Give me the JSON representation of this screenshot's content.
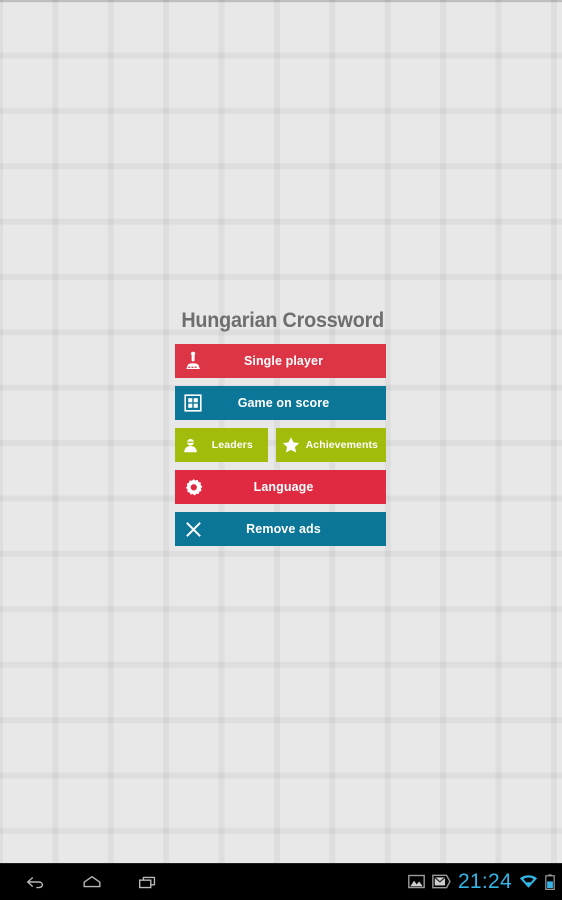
{
  "app": {
    "title": "Hungarian Crossword"
  },
  "menu": {
    "buttons": [
      {
        "id": "single-player",
        "label": "Single player",
        "icon": "joystick-icon",
        "color": "#dc3545"
      },
      {
        "id": "game-on-score",
        "label": "Game on score",
        "icon": "crossword-grid-icon",
        "color": "#0b7697"
      },
      {
        "id": "leaders",
        "label": "Leaders",
        "icon": "person-icon",
        "color": "#a3bb0a"
      },
      {
        "id": "achievements",
        "label": "Achievements",
        "icon": "star-icon",
        "color": "#a3bb0a"
      },
      {
        "id": "language",
        "label": "Language",
        "icon": "gear-icon",
        "color": "#e02a42"
      },
      {
        "id": "remove-ads",
        "label": "Remove ads",
        "icon": "close-x-icon",
        "color": "#0b7697"
      }
    ]
  },
  "navbar": {
    "back_label": "Back",
    "home_label": "Home",
    "recents_label": "Recent apps",
    "clock": "21:24",
    "status_icons": [
      "screenshot-icon",
      "email-icon",
      "wifi-icon",
      "battery-icon"
    ]
  },
  "colors": {
    "background": "#e8e8e8",
    "grid_line": "#dcdcdc",
    "title_text": "#6e6e6e",
    "red": "#dc3545",
    "red_alt": "#e02a42",
    "blue": "#0b7697",
    "green": "#a3bb0a",
    "clock_blue": "#33b5e5",
    "navbar": "#000000"
  }
}
